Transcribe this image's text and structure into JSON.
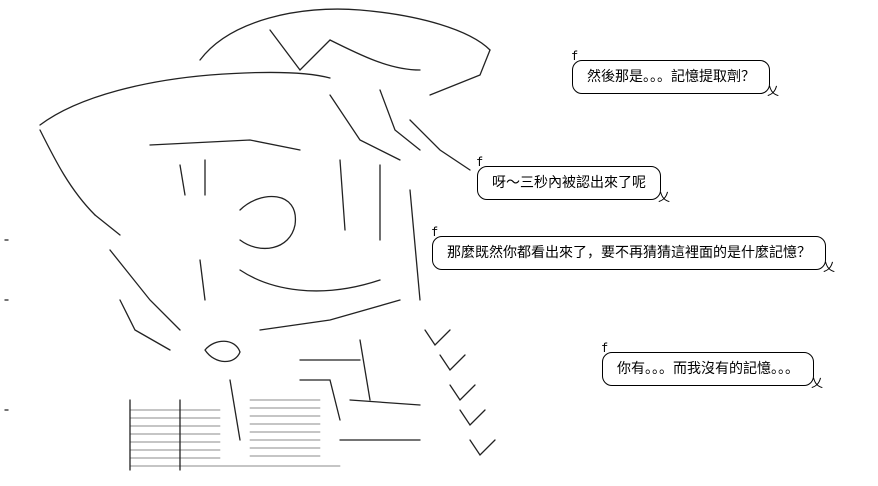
{
  "bubbles": [
    {
      "tag": "f",
      "text": "然後那是。。。記憶提取劑？",
      "tail": "乂"
    },
    {
      "tag": "f",
      "text": "呀～三秒內被認出來了呢",
      "tail": "乂"
    },
    {
      "tag": "f",
      "text": "那麼既然你都看出來了，要不再猜猜這裡面的是什麼記憶？",
      "tail": "乂"
    },
    {
      "tag": "f",
      "text": "你有。。。而我沒有的記憶。。。",
      "tail": "乂"
    }
  ],
  "figure": {
    "icon": "ascii-art-character-figure"
  }
}
